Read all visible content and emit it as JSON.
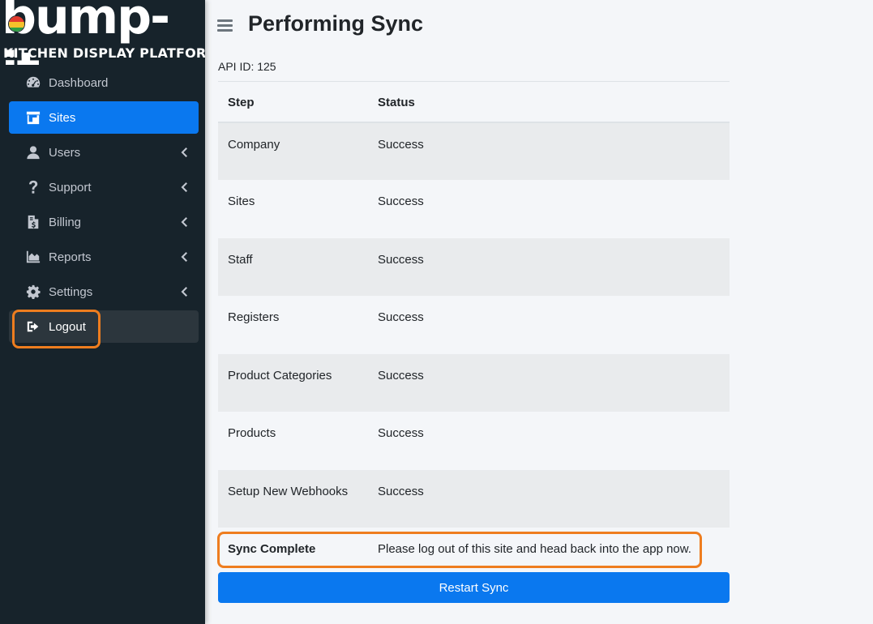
{
  "brand": {
    "title": "bump-it",
    "subtitle": "KITCHEN DISPLAY PLATFORM",
    "dot_colors": [
      "#e23b2e",
      "#f6c12b",
      "#2f9e44"
    ]
  },
  "sidebar": {
    "items": [
      {
        "label": "Dashboard",
        "icon": "tachometer-icon",
        "active": false,
        "has_chevron": false
      },
      {
        "label": "Sites",
        "icon": "store-icon",
        "active": true,
        "has_chevron": false
      },
      {
        "label": "Users",
        "icon": "user-icon",
        "active": false,
        "has_chevron": true
      },
      {
        "label": "Support",
        "icon": "question-icon",
        "active": false,
        "has_chevron": true
      },
      {
        "label": "Billing",
        "icon": "invoice-icon",
        "active": false,
        "has_chevron": true
      },
      {
        "label": "Reports",
        "icon": "chart-area-icon",
        "active": false,
        "has_chevron": true
      },
      {
        "label": "Settings",
        "icon": "gear-icon",
        "active": false,
        "has_chevron": true
      },
      {
        "label": "Logout",
        "icon": "sign-out-icon",
        "active": false,
        "has_chevron": false
      }
    ]
  },
  "header": {
    "title": "Performing Sync"
  },
  "main": {
    "api_id": "API ID: 125",
    "table": {
      "headers": [
        "Step",
        "Status"
      ],
      "rows": [
        {
          "step": "Company",
          "status": "Success"
        },
        {
          "step": "Sites",
          "status": "Success"
        },
        {
          "step": "Staff",
          "status": "Success"
        },
        {
          "step": "Registers",
          "status": "Success"
        },
        {
          "step": "Product Categories",
          "status": "Success"
        },
        {
          "step": "Products",
          "status": "Success"
        },
        {
          "step": "Setup New Webhooks",
          "status": "Success"
        }
      ],
      "final": {
        "step": "Sync Complete",
        "status": "Please log out of this site and head back into the app now."
      }
    },
    "restart_label": "Restart Sync"
  },
  "colors": {
    "sidebar_bg": "#17232b",
    "accent": "#0a78ef",
    "highlight": "#ee7d1f"
  }
}
